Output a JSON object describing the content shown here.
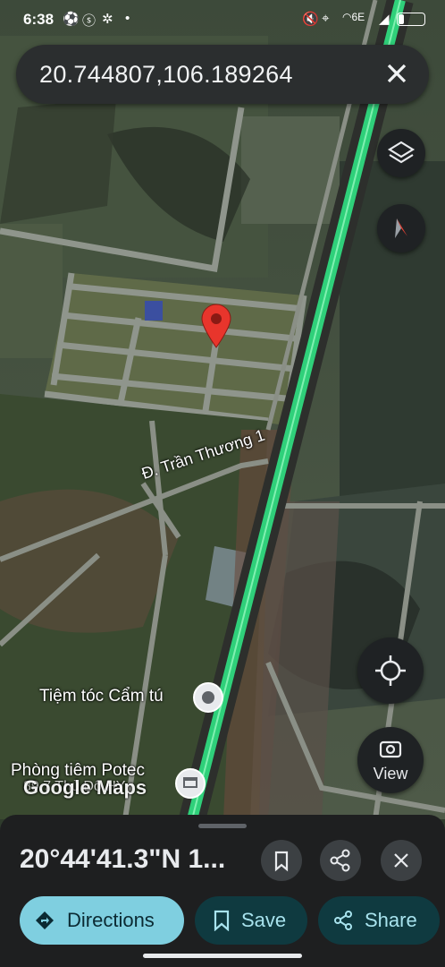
{
  "status_bar": {
    "time": "6:38",
    "left_icons": [
      "soccer-ball-icon",
      "s-circle-icon",
      "bug-icon",
      "dot-icon"
    ],
    "right_icons": [
      "mute-icon",
      "location-icon",
      "wifi-icon",
      "signal-icon",
      "battery-icon"
    ],
    "wifi_label": "6E",
    "battery_level": "low"
  },
  "search": {
    "query": "20.744807,106.189264",
    "close_icon": "close-icon"
  },
  "map": {
    "road_label": "Đ. Trần Thương 1",
    "places": [
      {
        "name": "Tiệm tóc Cẩm tú",
        "icon": "pin-circle-icon"
      },
      {
        "name": "Phòng tiêm Potec",
        "sub": "89.7 Thủ Đô HY",
        "icon": "building-icon"
      }
    ],
    "watermark": "Google Maps",
    "controls": {
      "layers_icon": "layers-icon",
      "compass_icon": "compass-icon",
      "locate_icon": "my-location-icon",
      "view_label": "View",
      "view_icon": "street-view-icon"
    },
    "colors": {
      "highway": "#2fd07a",
      "pin": "#e8352c"
    }
  },
  "sheet": {
    "coordinates": "20°44'41.3\"N 1...",
    "bookmark_icon": "bookmark-icon",
    "share_icon": "share-icon",
    "close_icon": "close-icon",
    "directions_label": "Directions",
    "save_label": "Save",
    "share_label": "Share",
    "accent": "#7fcfe0"
  }
}
